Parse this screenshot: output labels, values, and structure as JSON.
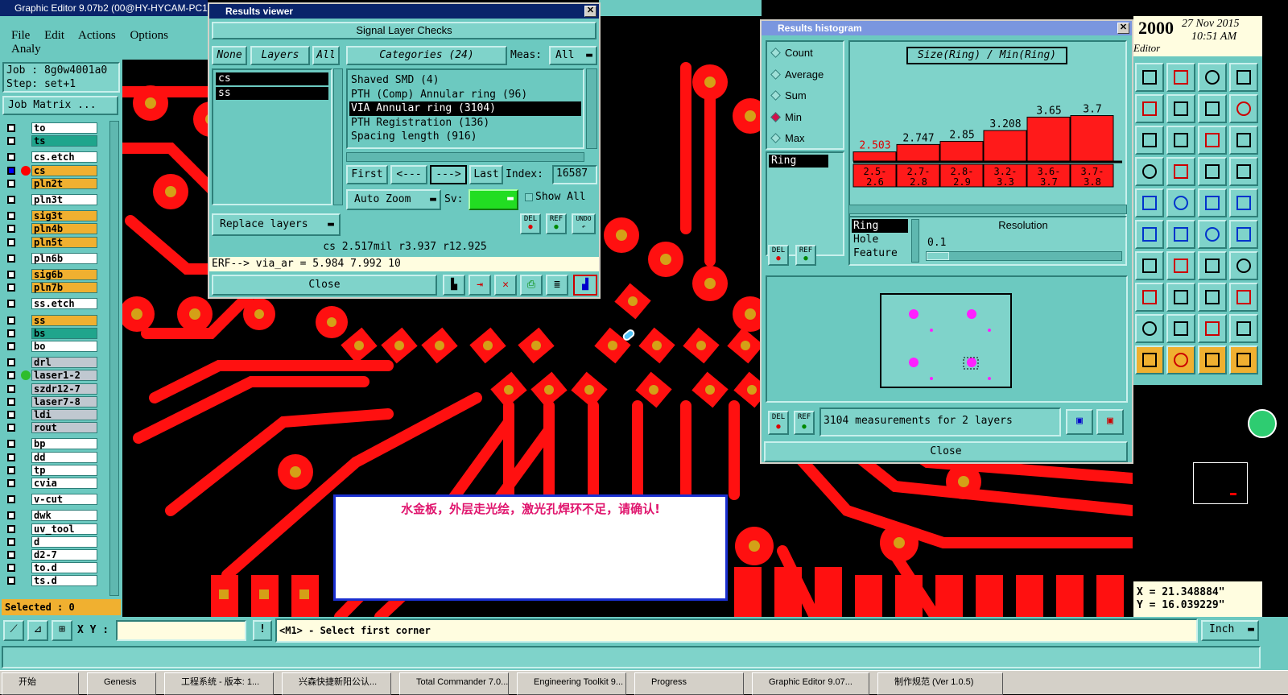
{
  "app": {
    "title": "Graphic Editor 9.07b2 (00@HY-HYCAM-PC1"
  },
  "menu": [
    "File",
    "Edit",
    "Actions",
    "Options",
    "Analy"
  ],
  "job": {
    "job_label": "Job : 8g0w4001a0",
    "step_label": "Step: set+1",
    "matrix_button": "Job Matrix ..."
  },
  "layers": [
    {
      "name": "to",
      "color": "#ffffff"
    },
    {
      "name": "ts",
      "color": "#1fa58c"
    },
    {
      "name": "cs.etch",
      "color": "#ffffff"
    },
    {
      "name": "cs",
      "color": "#f0b030"
    },
    {
      "name": "pln2t",
      "color": "#f0b030"
    },
    {
      "name": "pln3t",
      "color": "#ffffff"
    },
    {
      "name": "sig3t",
      "color": "#f0b030"
    },
    {
      "name": "pln4b",
      "color": "#f0b030"
    },
    {
      "name": "pln5t",
      "color": "#f0b030"
    },
    {
      "name": "pln6b",
      "color": "#ffffff"
    },
    {
      "name": "sig6b",
      "color": "#f0b030"
    },
    {
      "name": "pln7b",
      "color": "#f0b030"
    },
    {
      "name": "ss.etch",
      "color": "#ffffff"
    },
    {
      "name": "ss",
      "color": "#f0b030"
    },
    {
      "name": "bs",
      "color": "#1fa58c"
    },
    {
      "name": "bo",
      "color": "#ffffff"
    },
    {
      "name": "drl",
      "color": "#c0c8d0"
    },
    {
      "name": "laser1-2",
      "color": "#c0c8d0"
    },
    {
      "name": "szdr12-7",
      "color": "#c0c8d0"
    },
    {
      "name": "laser7-8",
      "color": "#c0c8d0"
    },
    {
      "name": "ldi",
      "color": "#c0c8d0"
    },
    {
      "name": "rout",
      "color": "#c0c8d0"
    },
    {
      "name": "bp",
      "color": "#ffffff"
    },
    {
      "name": "dd",
      "color": "#ffffff"
    },
    {
      "name": "tp",
      "color": "#ffffff"
    },
    {
      "name": "cvia",
      "color": "#ffffff"
    },
    {
      "name": "v-cut",
      "color": "#ffffff"
    },
    {
      "name": "dwk",
      "color": "#ffffff"
    },
    {
      "name": "uv_tool",
      "color": "#ffffff"
    },
    {
      "name": "d",
      "color": "#ffffff"
    },
    {
      "name": "d2-7",
      "color": "#ffffff"
    },
    {
      "name": "to.d",
      "color": "#ffffff"
    },
    {
      "name": "ts.d",
      "color": "#ffffff"
    }
  ],
  "selected": "Selected : 0",
  "results_viewer": {
    "title": "Results viewer",
    "heading": "Signal Layer Checks",
    "none_btn": "None",
    "layers_btn": "Layers",
    "all_btn": "All",
    "layer_list": [
      "cs",
      "ss"
    ],
    "categories_label": "Categories (24)",
    "meas_label": "Meas:",
    "meas_value": "All",
    "categories": [
      "Shaved SMD (4)",
      "PTH (Comp) Annular ring (96)",
      "VIA Annular ring (3104)",
      "PTH Registration (136)",
      "Spacing length (916)"
    ],
    "first": "First",
    "prev": "<---",
    "next": "--->",
    "last": "Last",
    "index_label": "Index:",
    "index_value": "16587",
    "auto_zoom": "Auto Zoom",
    "sv_label": "Sv:",
    "show_all": "Show All",
    "replace_layers": "Replace layers",
    "status_line": "cs 2.517mil   r3.937   r12.925",
    "erf_line": "ERF--> via_ar = 5.984 7.992 10",
    "close": "Close",
    "del": "DEL",
    "ref": "REF",
    "undo": "UNDO"
  },
  "histogram": {
    "title": "Results histogram",
    "modes": [
      "Count",
      "Average",
      "Sum",
      "Min",
      "Max"
    ],
    "selected_mode": "Min",
    "attr_value": "Ring",
    "chart_title": "Size(Ring) / Min(Ring)",
    "attrs": [
      "Ring",
      "Hole",
      "Feature"
    ],
    "resolution_label": "Resolution",
    "resolution_value": "0.1",
    "measurements": "3104 measurements for 2 layers",
    "close": "Close",
    "del": "DEL",
    "ref": "REF"
  },
  "chart_data": {
    "type": "bar",
    "title": "Size(Ring) / Min(Ring)",
    "categories": [
      "2.5-2.6",
      "2.7-2.8",
      "2.8-2.9",
      "3.2-3.3",
      "3.6-3.7",
      "3.7-3.8"
    ],
    "values": [
      2.503,
      2.747,
      2.85,
      3.208,
      3.65,
      3.7
    ],
    "value_labels": [
      "2.503",
      "2.747",
      "2.85",
      "3.208",
      "3.65",
      "3.7"
    ],
    "bar_color": "#ff1a1a"
  },
  "clock": {
    "year": "2000",
    "date": "27 Nov 2015",
    "time": "10:51 AM",
    "label": "Editor"
  },
  "coords": {
    "x": "X = 21.348884\"",
    "y": "Y = 16.039229\""
  },
  "alert": {
    "message": "水金板，外层走光绘，激光孔焊环不足，请确认!"
  },
  "bottom": {
    "xy_label": "X Y :",
    "xy_value": "",
    "prompt": "<M1> - Select first corner",
    "units": "Inch"
  },
  "taskbar": [
    "开始",
    "Genesis",
    "工程系统 - 版本: 1...",
    "兴森快捷新阳公认...",
    "Total Commander 7.0...",
    "Engineering Toolkit 9...",
    "Progress",
    "Graphic Editor 9.07...",
    "制作规范 (Ver 1.0.5)"
  ],
  "colors": {
    "teal": "#6cc9c0",
    "copper": "#ff0000",
    "pad": "#d4a017",
    "title_bar": "#0a246a"
  }
}
